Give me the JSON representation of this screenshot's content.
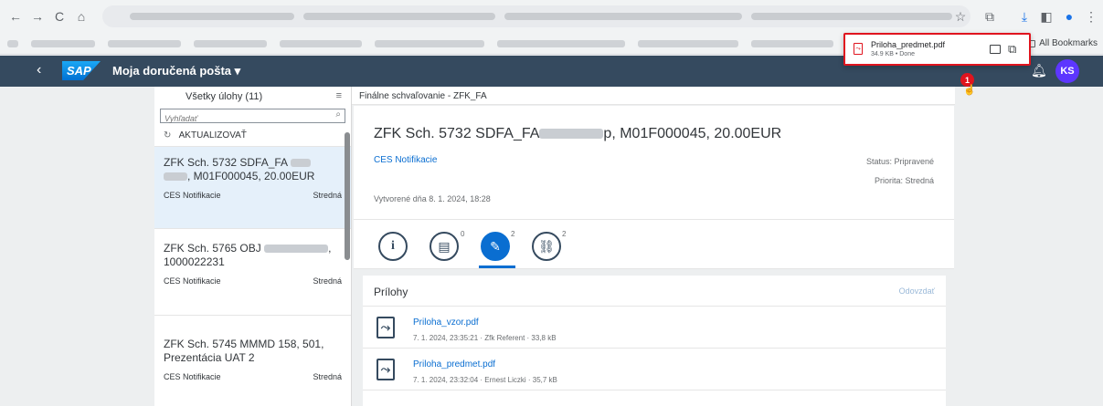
{
  "browser": {
    "nav": [
      "←",
      "→",
      "C",
      "⌂"
    ],
    "toolbar_icons": [
      "☆",
      "⧉",
      "⤓",
      "◧",
      "●",
      "⋮"
    ],
    "all_bookmarks": "All Bookmarks"
  },
  "download": {
    "file_name": "Priloha_predmet.pdf",
    "meta": "34.9 KB • Done",
    "badge": "1"
  },
  "shell": {
    "title": "Moja doručená pošta ▾",
    "logo": "SAP",
    "avatar": "KS"
  },
  "master": {
    "header": "Všetky úlohy (11)",
    "search_placeholder": "Vyhľadať",
    "refresh": "AKTUALIZOVAŤ",
    "items": [
      {
        "title_a": "ZFK Sch. 5732 SDFA_FA",
        "title_b": ", M01F000045, 20.00EUR",
        "source": "CES Notifikacie",
        "priority": "Stredná"
      },
      {
        "title_a": "ZFK Sch. 5765 OBJ",
        "title_b": "1000022231",
        "source": "CES Notifikacie",
        "priority": "Stredná"
      },
      {
        "title_a": "ZFK Sch. 5745 MMMD 158, 501,",
        "title_b": "Prezentácia UAT 2",
        "source": "CES Notifikacie",
        "priority": "Stredná"
      }
    ]
  },
  "detail": {
    "breadcrumb": "Finálne schvaľovanie - ZFK_FA",
    "title_a": "ZFK Sch. 5732 SDFA_FA",
    "title_b": "p, M01F000045, 20.00EUR",
    "subtitle": "CES Notifikacie",
    "created": "Vytvorené dňa 8. 1. 2024, 18:28",
    "status": "Status: Pripravené",
    "priority": "Priorita: Stredná",
    "tabs": [
      {
        "icon": "i",
        "count": ""
      },
      {
        "icon": "▤",
        "count": "0"
      },
      {
        "icon": "✎",
        "count": "2"
      },
      {
        "icon": "⛓",
        "count": "2"
      }
    ],
    "attachments": {
      "heading": "Prílohy",
      "upload": "Odovzdať",
      "items": [
        {
          "name": "Priloha_vzor.pdf",
          "meta": "7. 1. 2024, 23:35:21 · Zfk Referent · 33,8 kB"
        },
        {
          "name": "Priloha_predmet.pdf",
          "meta": "7. 1. 2024, 23:32:04 · Ernest Liczki · 35,7 kB"
        }
      ]
    }
  }
}
